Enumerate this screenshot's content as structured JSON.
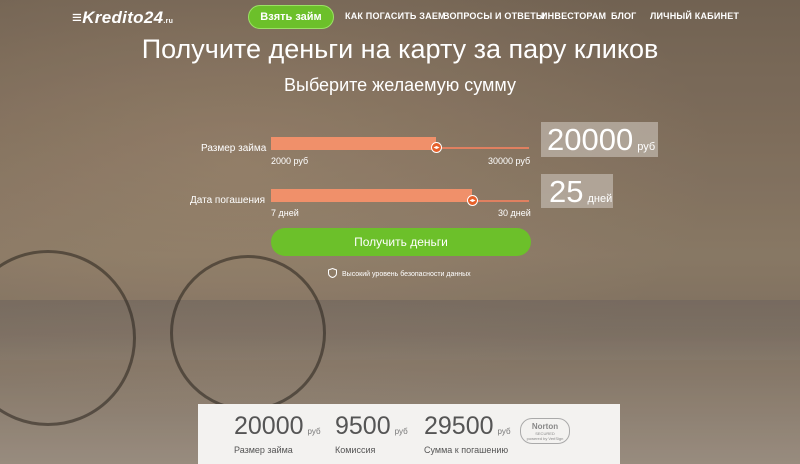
{
  "header": {
    "logo": "Kredito24",
    "logo_tld": ".ru",
    "cta": "Взять займ",
    "nav": [
      "КАК ПОГАСИТЬ ЗАЕМ",
      "ВОПРОСЫ И ОТВЕТЫ",
      "ИНВЕСТОРАМ",
      "БЛОГ",
      "ЛИЧНЫЙ КАБИНЕТ"
    ]
  },
  "hero": {
    "title": "Получите деньги на карту за пару кликов",
    "subtitle": "Выберите желаемую сумму"
  },
  "loan": {
    "label": "Размер займа",
    "min": "2000 руб",
    "max": "30000 руб",
    "value": "20000",
    "unit": "руб",
    "position": 0.64
  },
  "term": {
    "label": "Дата погашения",
    "min": "7 дней",
    "max": "30 дней",
    "value": "25",
    "unit": "дней",
    "position": 0.78
  },
  "submit": "Получить деньги",
  "security_note": "Высокий уровень безопасности данных",
  "summary": {
    "amount": {
      "value": "20000",
      "unit": "руб",
      "caption": "Размер займа"
    },
    "fee": {
      "value": "9500",
      "unit": "руб",
      "caption": "Комиссия"
    },
    "total": {
      "value": "29500",
      "unit": "руб",
      "caption": "Сумма к погашению"
    },
    "badge_title": "Norton",
    "badge_sub": "SECURED",
    "badge_by": "powered by VeriSign"
  },
  "colors": {
    "accent_green": "#6cc02a",
    "slider_orange": "#f0906a",
    "handle_orange": "#e6602a"
  }
}
